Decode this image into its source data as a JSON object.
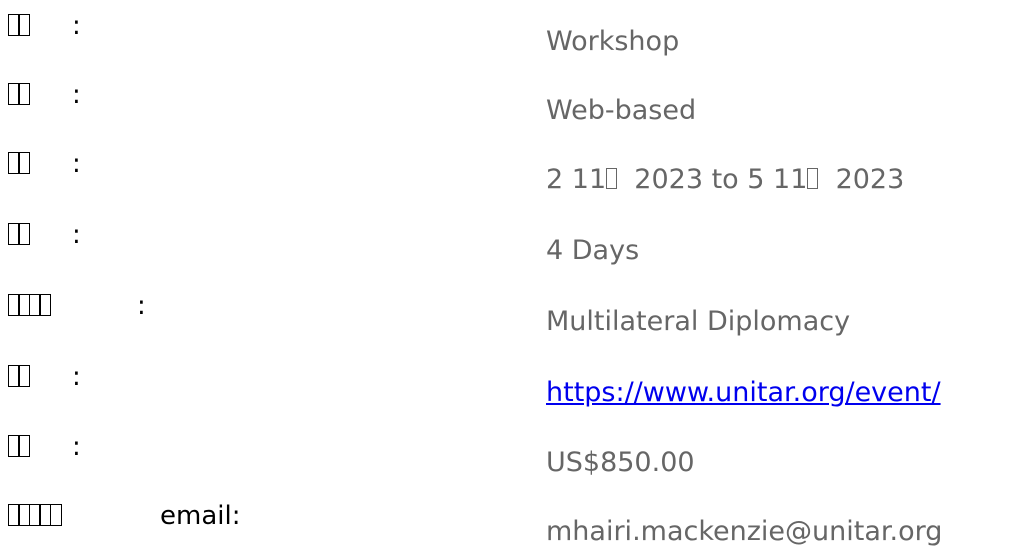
{
  "rows": [
    {
      "label_glyphs": 2,
      "label_suffix": "",
      "colon": ":",
      "value": "Workshop",
      "kind": "text"
    },
    {
      "label_glyphs": 2,
      "label_suffix": "",
      "colon": ":",
      "value": "Web-based",
      "kind": "text"
    },
    {
      "label_glyphs": 2,
      "label_suffix": "",
      "colon": ":",
      "value_parts": [
        "2 11",
        "2023 to 5 11",
        "2023"
      ],
      "kind": "date"
    },
    {
      "label_glyphs": 2,
      "label_suffix": "",
      "colon": ":",
      "value": "4 Days",
      "kind": "text"
    },
    {
      "label_glyphs": 4,
      "label_suffix": "",
      "colon": ":",
      "value": "Multilateral Diplomacy",
      "kind": "text"
    },
    {
      "label_glyphs": 2,
      "label_suffix": "",
      "colon": ":",
      "value": "https://www.unitar.org/event/",
      "kind": "link"
    },
    {
      "label_glyphs": 2,
      "label_suffix": "",
      "colon": ":",
      "value": "US$850.00",
      "kind": "text"
    },
    {
      "label_glyphs": 5,
      "label_suffix": "email:",
      "colon": "",
      "value": "mhairi.mackenzie@unitar.org",
      "kind": "text"
    }
  ],
  "colors": {
    "label": "#000000",
    "value": "#666666",
    "link": "#0000ee"
  }
}
